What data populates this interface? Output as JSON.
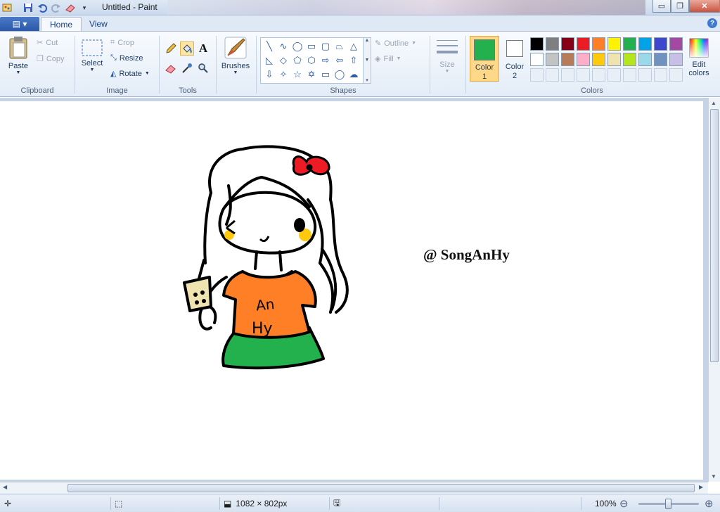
{
  "window": {
    "title": "Untitled - Paint",
    "buttons": {
      "minimize": "▭",
      "maximize": "❐",
      "close": "✕"
    }
  },
  "quick_access": [
    "paint-app-icon",
    "save-icon",
    "undo-icon",
    "redo-icon",
    "eraser-icon",
    "customize-dropdown-icon"
  ],
  "tabs": {
    "file_menu": "▤ ▾",
    "home": "Home",
    "view": "View",
    "help": "?"
  },
  "ribbon": {
    "clipboard": {
      "group_label": "Clipboard",
      "paste": "Paste",
      "cut": "Cut",
      "copy": "Copy"
    },
    "image": {
      "group_label": "Image",
      "select": "Select",
      "crop": "Crop",
      "resize": "Resize",
      "rotate": "Rotate"
    },
    "tools": {
      "group_label": "Tools",
      "text_tool": "A"
    },
    "brushes": {
      "label": "Brushes"
    },
    "shapes": {
      "group_label": "Shapes",
      "outline": "Outline",
      "fill": "Fill"
    },
    "size": {
      "label": "Size"
    },
    "colors": {
      "group_label": "Colors",
      "color1_line1": "Color",
      "color1_line2": "1",
      "color2_line1": "Color",
      "color2_line2": "2",
      "edit_line1": "Edit",
      "edit_line2": "colors",
      "color1_value": "#22b14c",
      "color2_value": "#ffffff",
      "palette_row1": [
        "#000000",
        "#7f7f7f",
        "#880015",
        "#ed1c24",
        "#ff7f27",
        "#fff200",
        "#22b14c",
        "#00a2e8",
        "#3f48cc",
        "#a349a4"
      ],
      "palette_row2": [
        "#ffffff",
        "#c3c3c3",
        "#b97a57",
        "#ffaec9",
        "#ffc90e",
        "#efe4b0",
        "#b5e61d",
        "#99d9ea",
        "#7092be",
        "#c8bfe7"
      ]
    }
  },
  "canvas": {
    "watermark_text": "@ SongAnHy",
    "shirt_text_line1": "An",
    "shirt_text_line2": "Hy"
  },
  "statusbar": {
    "image_size": "1082 × 802px",
    "zoom": "100%"
  }
}
